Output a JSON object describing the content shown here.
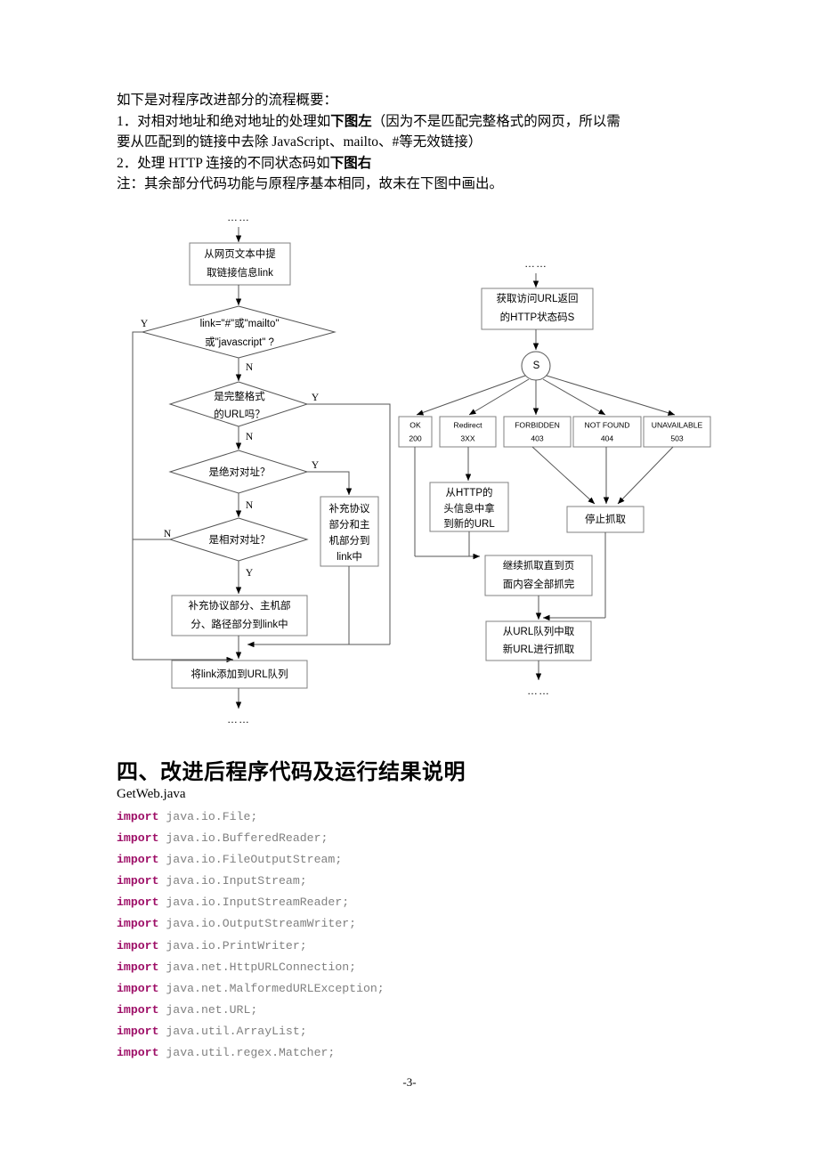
{
  "document": {
    "intro_lines": [
      "如下是对程序改进部分的流程概要：",
      "1．对相对地址和绝对地址的处理如",
      "下图左",
      "（因为不是匹配完整格式的网页，所以需",
      "要从匹配到的链接中去除 JavaScript、mailto、#等无效链接）",
      "2．处理 HTTP 连接的不同状态码如",
      "下图右",
      "注：其余部分代码功能与原程序基本相同，故未在下图中画出。"
    ],
    "section_heading": "四、改进后程序代码及运行结果说明",
    "code_filename": "GetWeb.java",
    "page_number": "-3-"
  },
  "left_flowchart": {
    "ellipsis_top": "……",
    "ellipsis_bottom": "……",
    "nodes": {
      "extract_link": [
        "从网页文本中提",
        "取链接信息link"
      ],
      "decide_invalid": [
        "link=\"#\"或\"mailto\"",
        "或\"javascript\" ?"
      ],
      "decide_full_url": [
        "是完整格式",
        "的URL吗？"
      ],
      "decide_absolute": [
        "是绝对对址？"
      ],
      "decide_relative": [
        "是相对对址？"
      ],
      "fill_proto_host": [
        "补充协议",
        "部分和主",
        "机部分到",
        "link中"
      ],
      "fill_proto_host_path": [
        "补充协议部分、主机部",
        "分、路径部分到link中"
      ],
      "add_to_queue": [
        "将link添加到URL队列"
      ]
    },
    "branch_labels": {
      "invalid_yes": "Y",
      "invalid_no": "N",
      "full_url_yes": "Y",
      "full_url_no": "N",
      "absolute_yes": "Y",
      "absolute_no": "N",
      "relative_no": "N",
      "relative_yes": "Y"
    }
  },
  "right_flowchart": {
    "ellipsis_top": "……",
    "ellipsis_bottom": "……",
    "nodes": {
      "get_status": [
        "获取访问URL返回",
        "的HTTP状态码S"
      ],
      "switch_node": "S",
      "get_new_url": [
        "从HTTP的",
        "头信息中拿",
        "到新的URL"
      ],
      "stop_fetch": [
        "停止抓取"
      ],
      "continue_fetch": [
        "继续抓取直到页",
        "面内容全部抓完"
      ],
      "next_url": [
        "从URL队列中取",
        "新URL进行抓取"
      ]
    },
    "status_boxes": [
      {
        "name": "OK",
        "code": "200"
      },
      {
        "name": "Redirect",
        "code": "3XX"
      },
      {
        "name": "FORBIDDEN",
        "code": "403"
      },
      {
        "name": "NOT FOUND",
        "code": "404"
      },
      {
        "name": "UNAVAILABLE",
        "code": "503"
      }
    ]
  },
  "code": {
    "lines": [
      {
        "keyword": "import",
        "rest": " java.io.File;"
      },
      {
        "keyword": "import",
        "rest": " java.io.BufferedReader;"
      },
      {
        "keyword": "import",
        "rest": " java.io.FileOutputStream;"
      },
      {
        "keyword": "import",
        "rest": " java.io.InputStream;"
      },
      {
        "keyword": "import",
        "rest": " java.io.InputStreamReader;"
      },
      {
        "keyword": "import",
        "rest": " java.io.OutputStreamWriter;"
      },
      {
        "keyword": "import",
        "rest": " java.io.PrintWriter;"
      },
      {
        "keyword": "import",
        "rest": " java.net.HttpURLConnection;"
      },
      {
        "keyword": "import",
        "rest": " java.net.MalformedURLException;"
      },
      {
        "keyword": "import",
        "rest": " java.net.URL;"
      },
      {
        "keyword": "import",
        "rest": " java.util.ArrayList;"
      },
      {
        "keyword": "import",
        "rest": " java.util.regex.Matcher;"
      }
    ]
  },
  "colors": {
    "keyword": "#9e1068",
    "code_text": "#8a8a8a",
    "line": "#555555",
    "box_border": "#808080"
  }
}
